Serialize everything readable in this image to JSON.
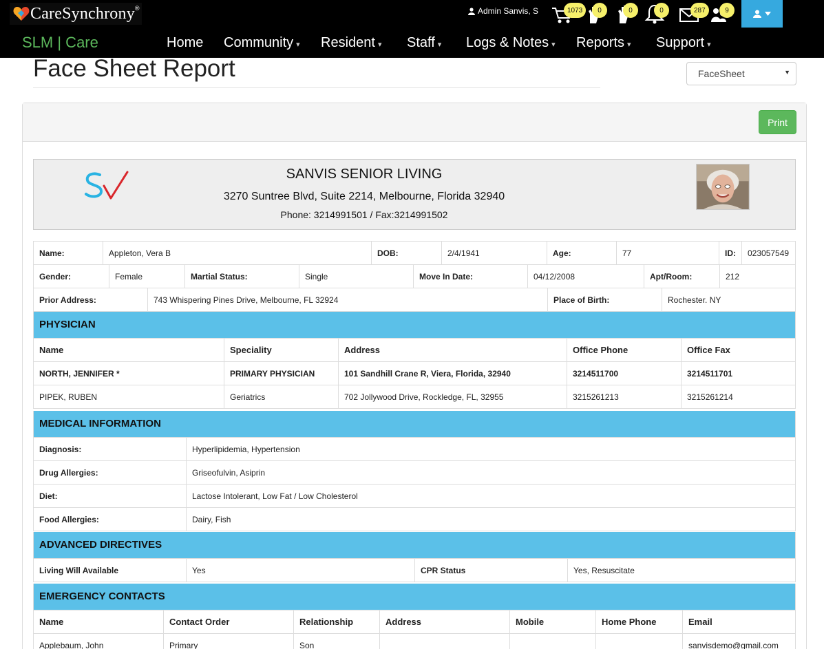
{
  "brand": {
    "name": "CareSynchrony",
    "reg": "®"
  },
  "topbar": {
    "user_name": "Admin Sanvis, S",
    "badges": {
      "cart": "1073",
      "tasks": "0",
      "incidents": "0",
      "alerts": "0",
      "messages": "287",
      "visitors": "9"
    },
    "icons": [
      "cart-icon",
      "hand-icon",
      "hand-icon",
      "bell-icon",
      "envelope-icon",
      "people-icon",
      "user-icon"
    ]
  },
  "nav": {
    "slm": "SLM | Care",
    "items": [
      "Home",
      "Community",
      "Resident",
      "Staff",
      "Logs & Notes",
      "Reports",
      "Support"
    ]
  },
  "page": {
    "title": "Face Sheet Report",
    "select_value": "FaceSheet",
    "print_label": "Print"
  },
  "facility": {
    "name": "SANVIS SENIOR LIVING",
    "address": "3270 Suntree Blvd, Suite 2214, Melbourne, Florida 32940",
    "phone": "Phone: 3214991501 / Fax:3214991502"
  },
  "resident": {
    "name_label": "Name:",
    "name": "Appleton, Vera B",
    "dob_label": "DOB:",
    "dob": "2/4/1941",
    "age_label": "Age:",
    "age": "77",
    "id_label": "ID:",
    "id": "023057549",
    "gender_label": "Gender:",
    "gender": "Female",
    "marital_label": "Martial Status:",
    "marital": "Single",
    "move_in_label": "Move In Date:",
    "move_in": "04/12/2008",
    "apt_label": "Apt/Room:",
    "apt": "212",
    "prior_label": "Prior Address:",
    "prior_address": "743 Whispering Pines Drive, Melbourne, FL 32924",
    "pob_label": "Place of Birth:",
    "pob": "Rochester. NY"
  },
  "physician": {
    "section": "PHYSICIAN",
    "headers": [
      "Name",
      "Speciality",
      "Address",
      "Office Phone",
      "Office Fax"
    ],
    "rows": [
      [
        "NORTH, JENNIFER *",
        "PRIMARY PHYSICIAN",
        "101 Sandhill Crane R, Viera, Florida, 32940",
        "3214511700",
        "3214511701"
      ],
      [
        "PIPEK, RUBEN",
        "Geriatrics",
        "702 Jollywood Drive, Rockledge, FL, 32955",
        "3215261213",
        "3215261214"
      ]
    ]
  },
  "medical": {
    "section": "MEDICAL INFORMATION",
    "rows": [
      [
        "Diagnosis:",
        "Hyperlipidemia, Hypertension"
      ],
      [
        "Drug Allergies:",
        "Griseofulvin, Asiprin"
      ],
      [
        "Diet:",
        "Lactose Intolerant, Low Fat / Low Cholesterol"
      ],
      [
        "Food Allergies:",
        "Dairy, Fish"
      ]
    ]
  },
  "directives": {
    "section": "ADVANCED DIRECTIVES",
    "living_will_label": "Living Will Available",
    "living_will": "Yes",
    "cpr_label": "CPR Status",
    "cpr": "Yes, Resuscitate"
  },
  "emergency": {
    "section": "EMERGENCY CONTACTS",
    "headers": [
      "Name",
      "Contact Order",
      "Relationship",
      "Address",
      "Mobile",
      "Home Phone",
      "Email"
    ],
    "rows": [
      [
        "Applebaum, John",
        "Primary",
        "Son",
        "",
        "",
        "",
        "sanvisdemo@gmail.com"
      ]
    ]
  },
  "colors": {
    "section_bg": "#5bc0e8",
    "print_btn": "#5cb85c",
    "user_btn": "#36a9df",
    "badge": "#f6f06a",
    "slm_text": "#5cb85c"
  }
}
